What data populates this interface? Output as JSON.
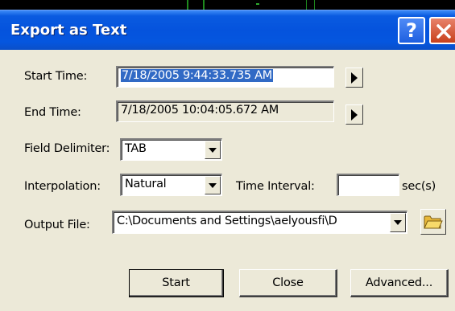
{
  "window": {
    "title": "Export as Text",
    "help_label": "?",
    "close_icon": "close-icon"
  },
  "form": {
    "start_time": {
      "label": "Start Time:",
      "value": "7/18/2005 9:44:33.735 AM"
    },
    "end_time": {
      "label": "End Time:",
      "value": "7/18/2005 10:04:05.672 AM"
    },
    "field_delimiter": {
      "label": "Field Delimiter:",
      "value": "TAB"
    },
    "interpolation": {
      "label": "Interpolation:",
      "value": "Natural"
    },
    "time_interval": {
      "label": "Time Interval:",
      "value": "",
      "unit": "sec(s)"
    },
    "output_file": {
      "label": "Output File:",
      "value": "C:\\Documents and Settings\\aelyousfi\\D"
    }
  },
  "buttons": {
    "start": "Start",
    "close": "Close",
    "advanced": "Advanced..."
  },
  "colors": {
    "titlebar": "#0553DD",
    "dialog_bg": "#ECE9D8",
    "selection": "#316AC5",
    "close_red": "#D9532E"
  }
}
